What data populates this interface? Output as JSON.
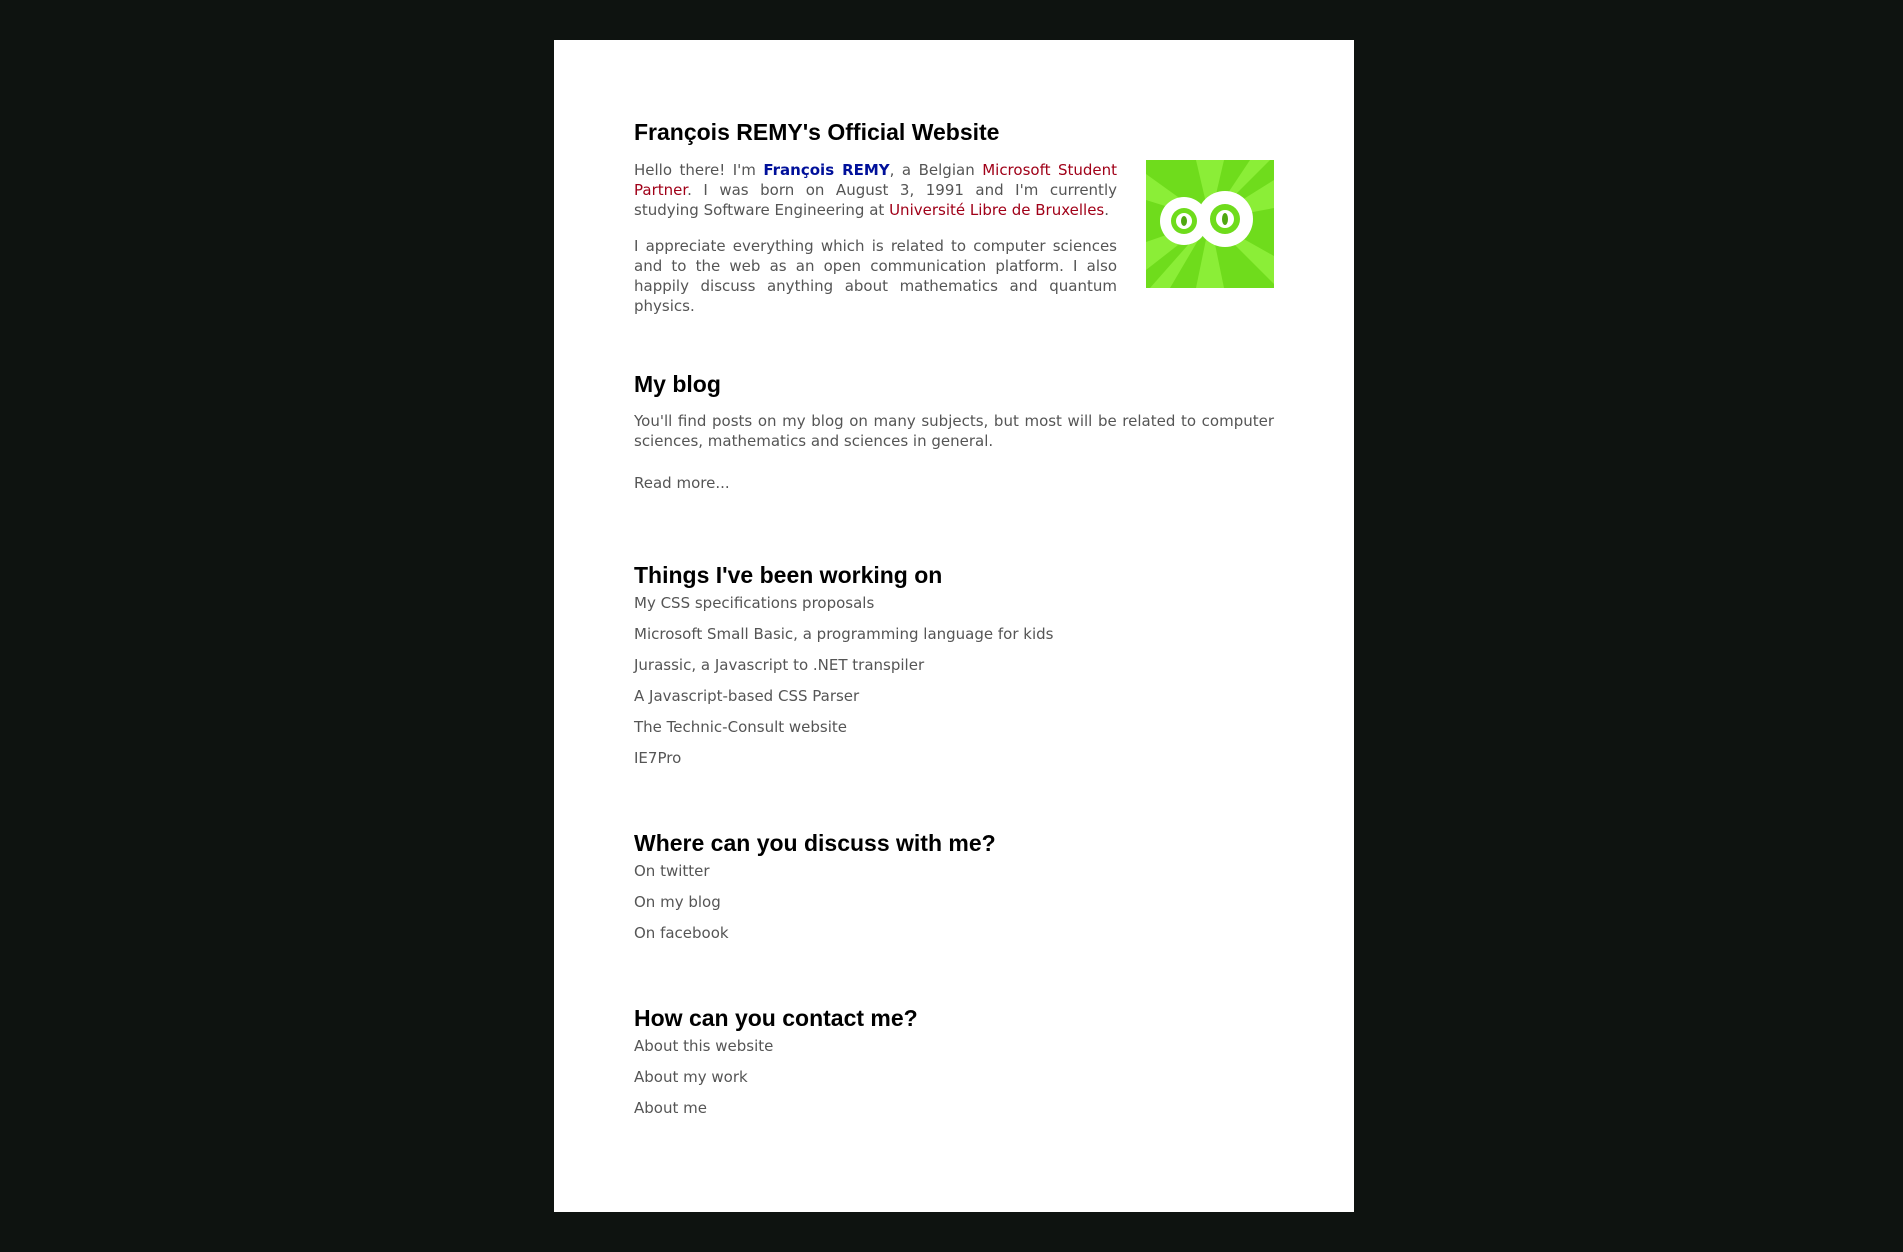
{
  "header": {
    "title": "François REMY's Official Website"
  },
  "intro": {
    "p1_a": "Hello there! I'm ",
    "name": "François REMY",
    "p1_b": ", a Belgian ",
    "msp": "Microsoft Student Partner",
    "p1_c": ". I was born on August 3, 1991 and I'm currently studying Software Engineering at ",
    "ulb": "Université Libre de Bruxelles",
    "p1_d": ".",
    "p2": "I appreciate everything which is related to computer sciences and to the web as an open communication platform. I also happily discuss anything about mathematics and quantum physics."
  },
  "colors": {
    "page_bg": "#0e1310",
    "content_bg": "#ffffff",
    "logo_green": "#6fdc1c",
    "name_link": "#00109a",
    "red_link": "#a00018"
  },
  "blog": {
    "title": "My blog",
    "text": "You'll find posts on my blog on many subjects, but most will be related to computer sciences, mathematics and sciences in general.",
    "read_more": "Read more..."
  },
  "work": {
    "title": "Things I've been working on",
    "items": [
      "My CSS specifications proposals",
      "Microsoft Small Basic, a programming language for kids",
      "Jurassic, a Javascript to .NET transpiler",
      "A Javascript-based CSS Parser",
      "The Technic-Consult website",
      "IE7Pro"
    ]
  },
  "discuss": {
    "title": "Where can you discuss with me?",
    "items": [
      "On twitter",
      "On my blog",
      "On facebook"
    ]
  },
  "contact": {
    "title": "How can you contact me?",
    "items": [
      "About this website",
      "About my work",
      "About me"
    ]
  },
  "logo": {
    "icon": "infinity-eyes-logo-icon"
  }
}
